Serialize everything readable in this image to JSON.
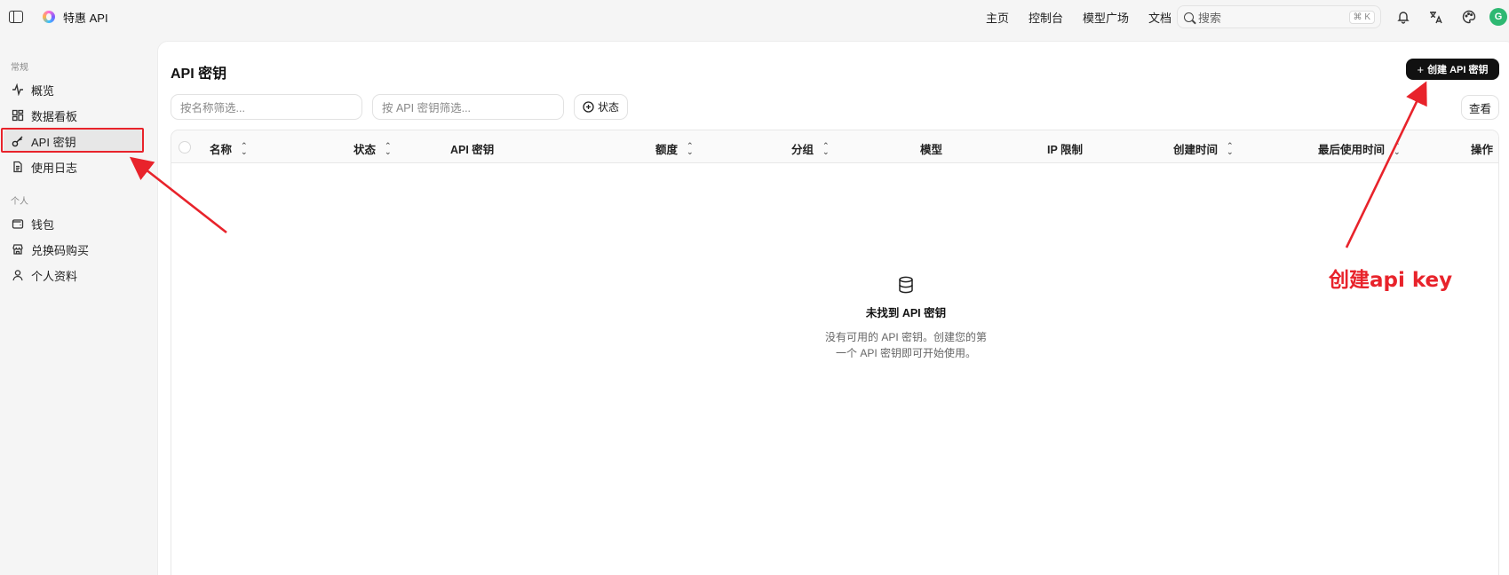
{
  "header": {
    "brand": "特惠 API",
    "nav": [
      "主页",
      "控制台",
      "模型广场",
      "文档"
    ],
    "search": {
      "placeholder": "搜索",
      "shortcut": "⌘ K"
    },
    "avatar_initial": "G",
    "icons": [
      "sidebar-toggle-icon",
      "bell-icon",
      "translate-icon",
      "palette-icon"
    ]
  },
  "sidebar": {
    "sections": [
      {
        "label": "常规",
        "items": [
          {
            "label": "概览",
            "icon": "activity-icon"
          },
          {
            "label": "数据看板",
            "icon": "dashboard-icon"
          },
          {
            "label": "API 密钥",
            "icon": "key-icon",
            "active": true
          },
          {
            "label": "使用日志",
            "icon": "file-text-icon"
          }
        ]
      },
      {
        "label": "个人",
        "items": [
          {
            "label": "钱包",
            "icon": "wallet-icon"
          },
          {
            "label": "兑换码购买",
            "icon": "store-icon"
          },
          {
            "label": "个人资料",
            "icon": "user-icon"
          }
        ]
      }
    ]
  },
  "main": {
    "title": "API 密钥",
    "create_button": "创建 API 密钥",
    "filters": {
      "name_placeholder": "按名称筛选...",
      "key_placeholder": "按 API 密钥筛选...",
      "status_label": "状态"
    },
    "view_button": "查看",
    "table": {
      "columns": [
        "名称",
        "状态",
        "API 密钥",
        "额度",
        "分组",
        "模型",
        "IP 限制",
        "创建时间",
        "最后使用时间",
        "操作"
      ]
    },
    "empty_state": {
      "title": "未找到 API 密钥",
      "description": "没有可用的 API 密钥。创建您的第一个 API 密钥即可开始使用。"
    }
  },
  "annotation": {
    "text": "创建api key",
    "color": "#e8232b"
  }
}
